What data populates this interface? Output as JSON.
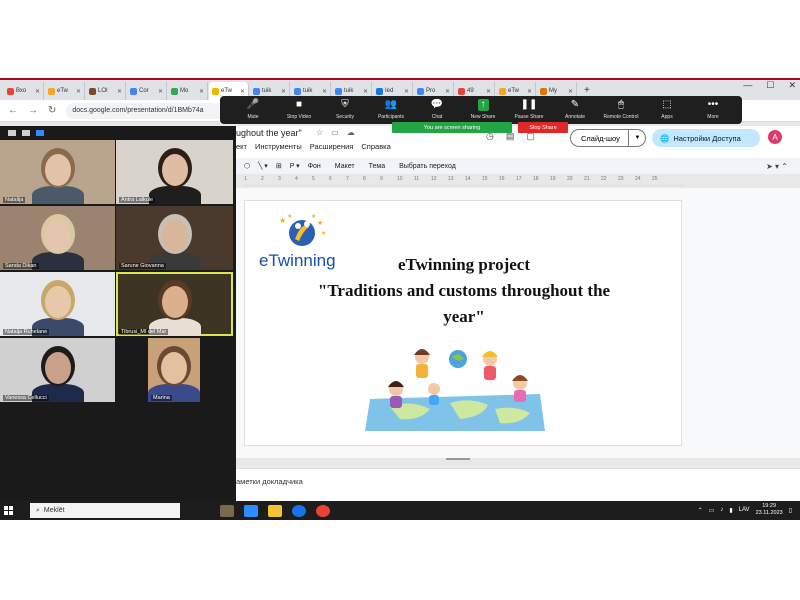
{
  "browser": {
    "tabs": [
      {
        "label": "Вхо",
        "color": "#ea4335"
      },
      {
        "label": "eTw",
        "color": "#f6a821"
      },
      {
        "label": "LOI",
        "color": "#7a4b2a"
      },
      {
        "label": "Cor",
        "color": "#4285f4"
      },
      {
        "label": "Mo",
        "color": "#34a853"
      },
      {
        "label": "eTw",
        "color": "#f4b400"
      },
      {
        "label": "tuik",
        "color": "#4285f4"
      },
      {
        "label": "tuik",
        "color": "#4285f4"
      },
      {
        "label": "tuik",
        "color": "#4285f4"
      },
      {
        "label": "Ied",
        "color": "#1a73e8"
      },
      {
        "label": "Pro",
        "color": "#4285f4"
      },
      {
        "label": "49",
        "color": "#ea4335"
      },
      {
        "label": "eTw",
        "color": "#f6a821"
      },
      {
        "label": "My",
        "color": "#e37400"
      }
    ],
    "active_tab_index": 5,
    "new_tab": "+",
    "url": "docs.google.com/presentation/d/1BMb74a",
    "window_controls": [
      "—",
      "☐",
      "✕"
    ]
  },
  "zoom_toolbar": {
    "buttons": [
      {
        "label": "Mute",
        "icon": "🎤"
      },
      {
        "label": "Stop Video",
        "icon": "■"
      },
      {
        "label": "Security",
        "icon": "⛨"
      },
      {
        "label": "Participants",
        "icon": "👥"
      },
      {
        "label": "Chat",
        "icon": "💬"
      },
      {
        "label": "New Share",
        "icon": "↑"
      },
      {
        "label": "Pause Share",
        "icon": "❚❚"
      },
      {
        "label": "Annotate",
        "icon": "✎"
      },
      {
        "label": "Remote Control",
        "icon": "🖱"
      },
      {
        "label": "Apps",
        "icon": "⬚"
      },
      {
        "label": "More",
        "icon": "•••"
      }
    ],
    "sharing_banner": "You are screen sharing",
    "stop_share": "Stop Share"
  },
  "participants": [
    {
      "name": "Natalija",
      "bg": "#b9a58e",
      "skin": "#e2c2a8",
      "hair": "#8a6a4a",
      "shirt": "#4a5a6a"
    },
    {
      "name": "Antra Lalkule",
      "bg": "#d8d4cc",
      "skin": "#e0bca0",
      "hair": "#2a2018",
      "shirt": "#1e1e1e"
    },
    {
      "name": "Sanda Dikan",
      "bg": "#9a8470",
      "skin": "#e4c6ae",
      "hair": "#d9c9a2",
      "shirt": "#2a3040"
    },
    {
      "name": "Sarune Giovanna",
      "bg": "#4a3a2e",
      "skin": "#d8b69a",
      "hair": "#c8c0b4",
      "shirt": "#3a3a3a"
    },
    {
      "name": "Natalja Ruhelane",
      "bg": "#e6e8ec",
      "skin": "#e8c8aa",
      "hair": "#c7a86a",
      "shirt": "#3a4a6a"
    },
    {
      "name": "Tibrusi_MI del Mar",
      "bg": "#3e3424",
      "skin": "#dcb08e",
      "hair": "#5a3a22",
      "shirt": "#e8e0d4"
    },
    {
      "name": "Vanessa Cellucci",
      "bg": "#d0d0d0",
      "skin": "#caa088",
      "hair": "#1c1c1c",
      "shirt": "#1e2a4a"
    },
    {
      "name": "Marina",
      "bg": "#caa078",
      "skin": "#e2c0a0",
      "hair": "#6a4a32",
      "shirt": "#3a4a8a"
    }
  ],
  "slides": {
    "doc_title": "ughout the year\"",
    "menu": [
      "ект",
      "Инструменты",
      "Расширения",
      "Справка"
    ],
    "slideshow_button": "Слайд-шоу",
    "access_button": "Настройки Доступа",
    "avatar_letter": "A",
    "toolbar": [
      "Фон",
      "Макет",
      "Тема",
      "Выбрать переход"
    ],
    "ruler": [
      "1",
      "2",
      "3",
      "4",
      "5",
      "6",
      "7",
      "8",
      "9",
      "10",
      "11",
      "12",
      "13",
      "14",
      "15",
      "16",
      "17",
      "18",
      "19",
      "20",
      "21",
      "22",
      "23",
      "24",
      "25"
    ],
    "slide": {
      "logo_text": "eTwinning",
      "line1": "eTwinning project",
      "line2": "\"Traditions and customs throughout the",
      "line3": "year\""
    },
    "speaker_notes": "аметки докладчика"
  },
  "taskbar": {
    "search_placeholder": "Meklēt",
    "language": "LAV",
    "time": "19:29",
    "date": "23.11.2023"
  }
}
